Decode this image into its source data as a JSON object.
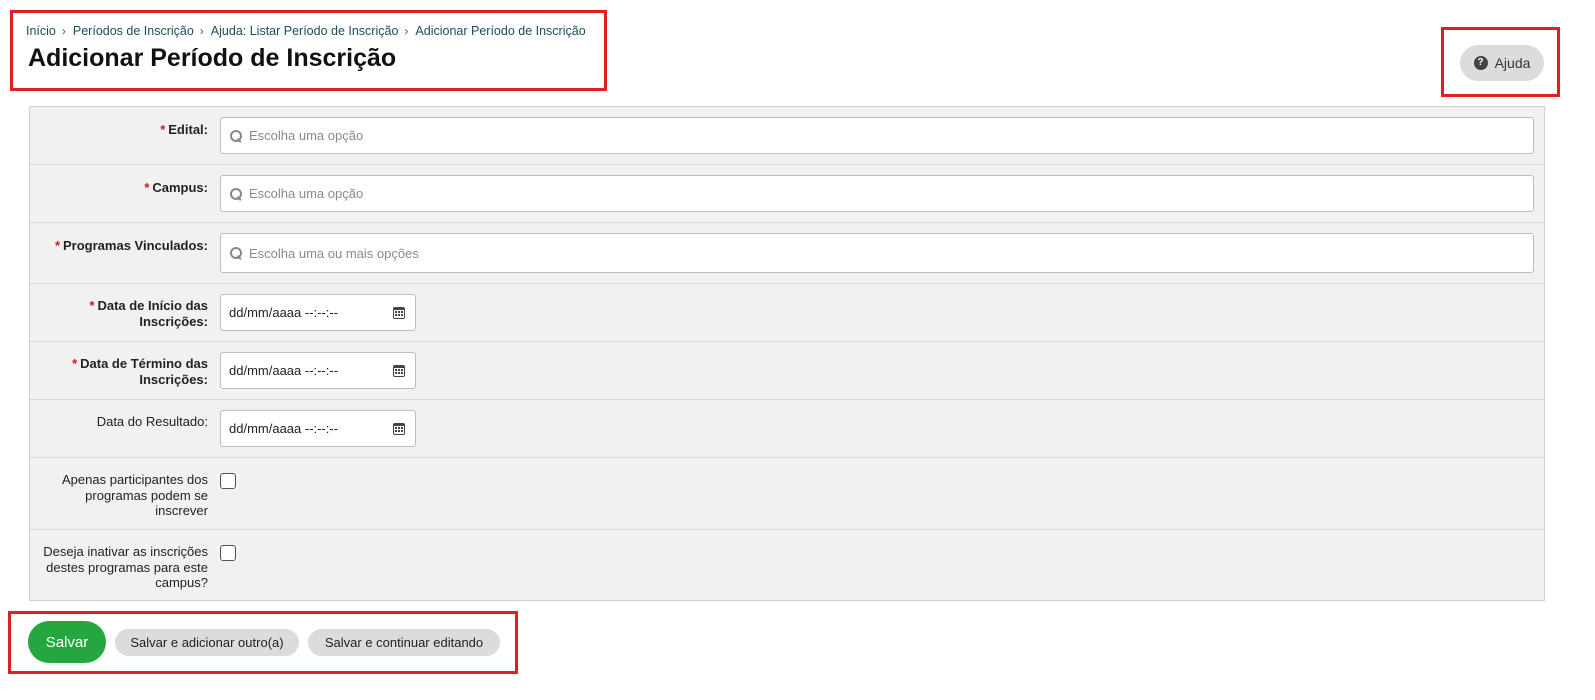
{
  "breadcrumb": {
    "items": [
      "Início",
      "Períodos de Inscrição",
      "Ajuda: Listar Período de Inscrição",
      "Adicionar Período de Inscrição"
    ]
  },
  "page_title": "Adicionar Período de Inscrição",
  "help_button": {
    "label": "Ajuda",
    "icon": "question-circle-icon"
  },
  "form": {
    "edital": {
      "label": "Edital:",
      "required": true,
      "placeholder": "Escolha uma opção"
    },
    "campus": {
      "label": "Campus:",
      "required": true,
      "placeholder": "Escolha uma opção"
    },
    "programas": {
      "label": "Programas Vinculados:",
      "required": true,
      "placeholder": "Escolha uma ou mais opções"
    },
    "data_inicio": {
      "label": "Data de Início das Inscrições:",
      "required": true,
      "value": "dd/mm/aaaa --:--:--"
    },
    "data_termino": {
      "label": "Data de Término das Inscrições:",
      "required": true,
      "value": "dd/mm/aaaa --:--:--"
    },
    "data_resultado": {
      "label": "Data do Resultado:",
      "required": false,
      "value": "dd/mm/aaaa --:--:--"
    },
    "apenas_participantes": {
      "label": "Apenas participantes dos programas podem se inscrever",
      "checked": false
    },
    "inativar_inscricoes": {
      "label": "Deseja inativar as inscrições destes programas para este campus?",
      "checked": false
    }
  },
  "actions": {
    "save": "Salvar",
    "save_add": "Salvar e adicionar outro(a)",
    "save_continue": "Salvar e continuar editando"
  },
  "colors": {
    "primary_button": "#26a63f",
    "required_mark": "#c9181f",
    "highlight_border": "#e02020"
  }
}
